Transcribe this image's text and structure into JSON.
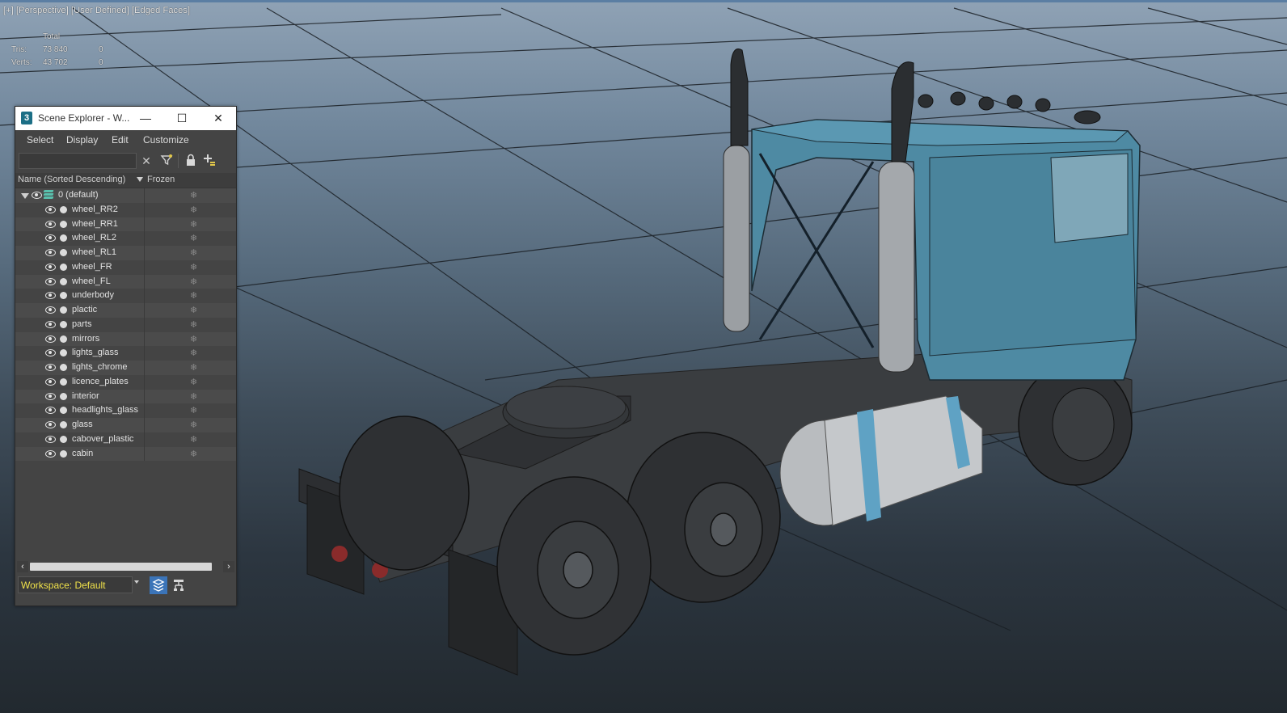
{
  "viewport": {
    "label": "[+] [Perspective] [User Defined] [Edged Faces]",
    "stats": {
      "total_label": "Total",
      "tris_label": "Tris:",
      "tris_total": "73 840",
      "tris_selected": "0",
      "verts_label": "Verts:",
      "verts_total": "43 702",
      "verts_selected": "0"
    }
  },
  "scene_explorer": {
    "title": "Scene Explorer - W...",
    "window_controls": {
      "minimize": "—",
      "maximize": "☐",
      "close": "✕"
    },
    "menu": [
      "Select",
      "Display",
      "Edit",
      "Customize"
    ],
    "search_value": "",
    "columns": {
      "name": "Name (Sorted Descending)",
      "frozen": "Frozen"
    },
    "root_layer": "0 (default)",
    "objects": [
      "wheel_RR2",
      "wheel_RR1",
      "wheel_RL2",
      "wheel_RL1",
      "wheel_FR",
      "wheel_FL",
      "underbody",
      "plactic",
      "parts",
      "mirrors",
      "lights_glass",
      "lights_chrome",
      "licence_plates",
      "interior",
      "headlights_glass",
      "glass",
      "cabover_plastic",
      "cabin"
    ],
    "workspace": "Workspace: Default"
  },
  "colors": {
    "workspace_text": "#f0e24a",
    "truck_cab": "#4e8aa3",
    "active_button": "#3b74b8"
  }
}
